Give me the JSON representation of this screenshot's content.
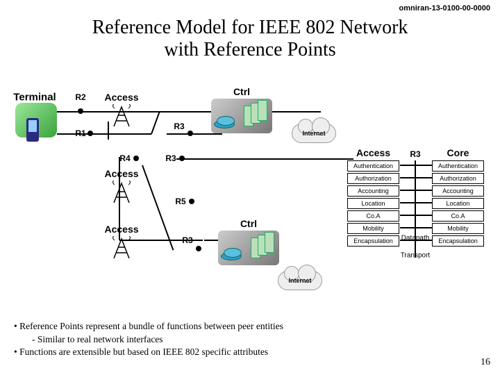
{
  "doc_id": "omniran-13-0100-00-0000",
  "title_line1": "Reference Model for IEEE 802 Network",
  "title_line2": "with Reference Points",
  "page_number": "16",
  "labels": {
    "terminal": "Terminal",
    "access": "Access",
    "ctrl": "Ctrl",
    "core": "Core",
    "internet": "Internet"
  },
  "ref_points": {
    "r1": "R1",
    "r2": "R2",
    "r3": "R3",
    "r4": "R4",
    "r5": "R5"
  },
  "entities": {
    "authentication": "Authentication",
    "authorization": "Authorization",
    "accounting": "Accounting",
    "location": "Location",
    "coa": "Co.A",
    "mobility": "Mobility",
    "encapsulation": "Encapsulation"
  },
  "mid_labels": {
    "datapath": "Datapath",
    "transport": "Transport"
  },
  "bullets": {
    "b1": "Reference Points represent a bundle of functions between peer entities",
    "b1a": "Similar to real network interfaces",
    "b2": "Functions are extensible but based on IEEE 802 specific attributes"
  }
}
